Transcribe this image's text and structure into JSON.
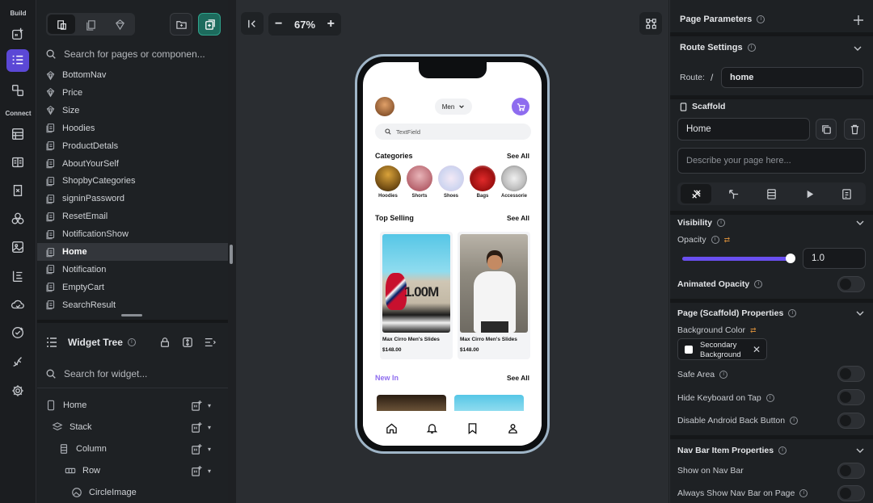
{
  "sidebar": {
    "build_label": "Build",
    "connect_label": "Connect",
    "icons": [
      "add-widget-icon",
      "widget-tree-icon",
      "components-icon",
      "firestore-icon",
      "api-icon",
      "app-state-icon",
      "theme-icon",
      "media-icon",
      "custom-code-icon",
      "cloud-icon",
      "tests-icon",
      "integrations-icon",
      "settings-icon"
    ]
  },
  "pages_panel": {
    "search_placeholder": "Search for pages or componen...",
    "items": [
      {
        "label": "BottomNav",
        "icon": "component-icon"
      },
      {
        "label": "Price",
        "icon": "component-icon"
      },
      {
        "label": "Size",
        "icon": "component-icon"
      },
      {
        "label": "Hoodies",
        "icon": "page-icon"
      },
      {
        "label": "ProductDetals",
        "icon": "page-icon"
      },
      {
        "label": "AboutYourSelf",
        "icon": "page-icon"
      },
      {
        "label": "ShopbyCategories",
        "icon": "page-icon"
      },
      {
        "label": "signinPassword",
        "icon": "page-icon"
      },
      {
        "label": "ResetEmail",
        "icon": "page-icon"
      },
      {
        "label": "NotificationShow",
        "icon": "page-icon"
      },
      {
        "label": "Home",
        "icon": "page-icon",
        "selected": true
      },
      {
        "label": "Notification",
        "icon": "page-icon"
      },
      {
        "label": "EmptyCart",
        "icon": "page-icon"
      },
      {
        "label": "SearchResult",
        "icon": "page-icon"
      }
    ]
  },
  "widget_tree": {
    "title": "Widget Tree",
    "search_placeholder": "Search for widget...",
    "nodes": [
      {
        "label": "Home",
        "depth": 0,
        "icon": "phone-icon"
      },
      {
        "label": "Stack",
        "depth": 1,
        "icon": "stack-icon"
      },
      {
        "label": "Column",
        "depth": 2,
        "icon": "column-icon"
      },
      {
        "label": "Row",
        "depth": 3,
        "icon": "row-icon"
      },
      {
        "label": "CircleImage",
        "depth": 4,
        "icon": "circle-image-icon"
      }
    ]
  },
  "canvas": {
    "zoom": "67%",
    "zoom_minus": "−",
    "zoom_plus": "+"
  },
  "phone": {
    "gender_dropdown": "Men",
    "search_placeholder": "TextField",
    "categories_title": "Categories",
    "see_all": "See All",
    "categories": [
      "Hoodies",
      "Shorts",
      "Shoes",
      "Bags",
      "Accessorie"
    ],
    "top_selling_title": "Top Selling",
    "products": [
      {
        "name": "Max Cirro Men's Slides",
        "price": "$148.00"
      },
      {
        "name": "Max Cirro Men's Slides",
        "price": "$148.00"
      }
    ],
    "slide_print": "1.00M",
    "new_in_title": "New In",
    "accent": "#8e6cef"
  },
  "properties": {
    "page_parameters": "Page Parameters",
    "route_settings": "Route Settings",
    "route_label": "Route:",
    "route_slash": "/",
    "route_value": "home",
    "scaffold_title": "Scaffold",
    "page_name": "Home",
    "description_placeholder": "Describe your page here...",
    "visibility": "Visibility",
    "opacity_label": "Opacity",
    "opacity_value": "1.0",
    "animated_opacity": "Animated Opacity",
    "scaffold_props": "Page (Scaffold) Properties",
    "bg_color_label": "Background Color",
    "bg_color_value_line1": "Secondary",
    "bg_color_value_line2": "Background",
    "safe_area": "Safe Area",
    "hide_keyboard": "Hide Keyboard on Tap",
    "disable_back": "Disable Android Back Button",
    "nav_bar_props": "Nav Bar Item Properties",
    "show_nav_bar": "Show on Nav Bar",
    "always_show_nav": "Always Show Nav Bar on Page",
    "slider_color": "#6a4ff0",
    "opacity_fraction": 1.0
  }
}
